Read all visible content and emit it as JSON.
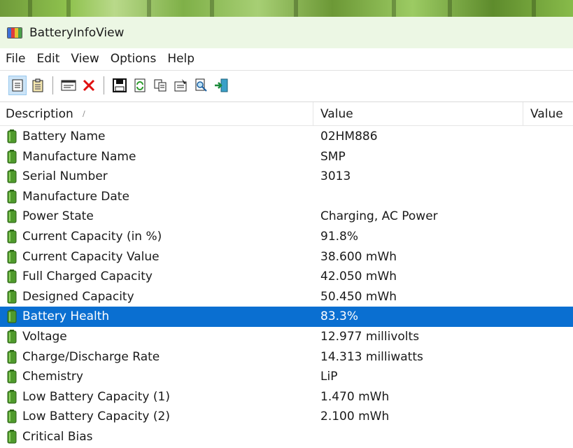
{
  "window": {
    "title": "BatteryInfoView"
  },
  "menu": [
    "File",
    "Edit",
    "View",
    "Options",
    "Help"
  ],
  "toolbar": {
    "buttons": [
      {
        "icon": "properties-view-icon",
        "active": true
      },
      {
        "icon": "list-view-icon",
        "active": false
      },
      {
        "icon": "window-icon",
        "active": false
      },
      {
        "icon": "delete-x-icon",
        "active": false
      },
      {
        "icon": "save-icon",
        "active": false
      },
      {
        "icon": "refresh-icon",
        "active": false
      },
      {
        "icon": "copy-icon",
        "active": false
      },
      {
        "icon": "properties-icon",
        "active": false
      },
      {
        "icon": "find-icon",
        "active": false
      },
      {
        "icon": "exit-icon",
        "active": false
      }
    ]
  },
  "table": {
    "columns": [
      "Description",
      "Value",
      "Value"
    ],
    "sort_indicator": "∕",
    "rows": [
      {
        "desc": "Battery Name",
        "value": "02HM886"
      },
      {
        "desc": "Manufacture Name",
        "value": "SMP"
      },
      {
        "desc": "Serial Number",
        "value": " 3013"
      },
      {
        "desc": "Manufacture Date",
        "value": ""
      },
      {
        "desc": "Power State",
        "value": "Charging, AC Power"
      },
      {
        "desc": "Current Capacity (in %)",
        "value": "91.8%"
      },
      {
        "desc": "Current Capacity Value",
        "value": "38.600 mWh"
      },
      {
        "desc": "Full Charged Capacity",
        "value": "42.050 mWh"
      },
      {
        "desc": "Designed Capacity",
        "value": "50.450 mWh"
      },
      {
        "desc": "Battery Health",
        "value": "83.3%",
        "selected": true
      },
      {
        "desc": "Voltage",
        "value": "12.977 millivolts"
      },
      {
        "desc": "Charge/Discharge Rate",
        "value": "14.313 milliwatts"
      },
      {
        "desc": "Chemistry",
        "value": "LiP"
      },
      {
        "desc": "Low Battery Capacity (1)",
        "value": "1.470 mWh"
      },
      {
        "desc": "Low Battery Capacity (2)",
        "value": "2.100 mWh"
      },
      {
        "desc": "Critical Bias",
        "value": ""
      }
    ]
  },
  "colors": {
    "selection": "#0a6fd1",
    "titlebar": "#ecf7e4",
    "battery": "#4f9a2c"
  }
}
